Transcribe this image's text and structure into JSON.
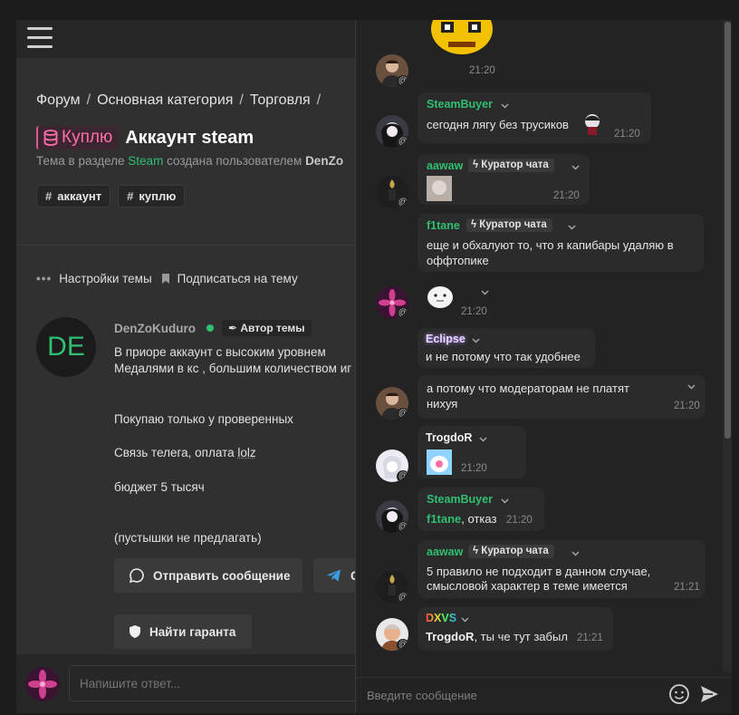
{
  "forum": {
    "breadcrumb": [
      "Форум",
      "Основная категория",
      "Торговля"
    ],
    "thread": {
      "prefix": "Куплю",
      "title": "Аккаунт steam",
      "subtitle_before": "Тема в разделе ",
      "subtitle_section": "Steam",
      "subtitle_middle": " создана пользователем ",
      "subtitle_user": "DenZo",
      "tags": [
        "аккаунт",
        "куплю"
      ]
    },
    "thread_settings_label": "Настройки темы",
    "subscribe_label": "Подписаться на тему",
    "post": {
      "avatar_text": "DE",
      "author": "DenZoKuduro",
      "author_badge": "Автор темы",
      "lines": {
        "l1": "В приоре аккаунт с высоким уровнем",
        "l2": "Медалями в кс , большим количеством иг",
        "l3": "Покупаю только у проверенных",
        "l4_before": "Связь телега, оплата ",
        "l4_link": "lolz",
        "l5": "бюджет 5 тысяч",
        "l6": "(пустышки не предлагать)"
      }
    },
    "buttons": {
      "send_message": "Отправить сообщение",
      "telegram": "С",
      "find_guarantor": "Найти гаранта"
    },
    "reply_placeholder": "Напишите ответ..."
  },
  "chat": {
    "curator_label": "Куратор чата",
    "messages": [
      {
        "time": "21:20"
      },
      {
        "user": "SteamBuyer",
        "text": "сегодня лягу без трусиков",
        "time": "21:20"
      },
      {
        "user": "aawaw",
        "time": "21:20"
      },
      {
        "user": "f1tane",
        "line1": "еще и обхалуют то, что я капибары удаляю в",
        "line2": "оффтопике"
      },
      {
        "time": "21:20"
      },
      {
        "user": "Eclipse",
        "text": "и не потому что так удобнее"
      },
      {
        "line1": "а потому что модераторам не платят",
        "line2": "нихуя",
        "time": "21:20"
      },
      {
        "user": "TrogdoR",
        "time": "21:20"
      },
      {
        "user": "SteamBuyer",
        "mention": "f1tane",
        "text": ", отказ",
        "time": "21:20"
      },
      {
        "user": "aawaw",
        "line1": "5 правило не подходит в данном случае,",
        "line2": "смысловой характер в теме имеется",
        "time": "21:21"
      },
      {
        "user": "DXVS",
        "mention": "TrogdoR",
        "text": ", ты че тут забыл",
        "time": "21:21"
      }
    ],
    "input_placeholder": "Введите сообщение"
  },
  "colors": {
    "accent_green": "#2fbf71",
    "prefix_pink": "#ff6fa5",
    "background": "#272727"
  },
  "icons": [
    "menu-icon",
    "database-icon",
    "more-dots-icon",
    "bookmark-icon",
    "chat-bubble-icon",
    "telegram-icon",
    "shield-icon",
    "chevron-down-icon",
    "lightning-icon",
    "emoji-icon",
    "send-icon"
  ]
}
